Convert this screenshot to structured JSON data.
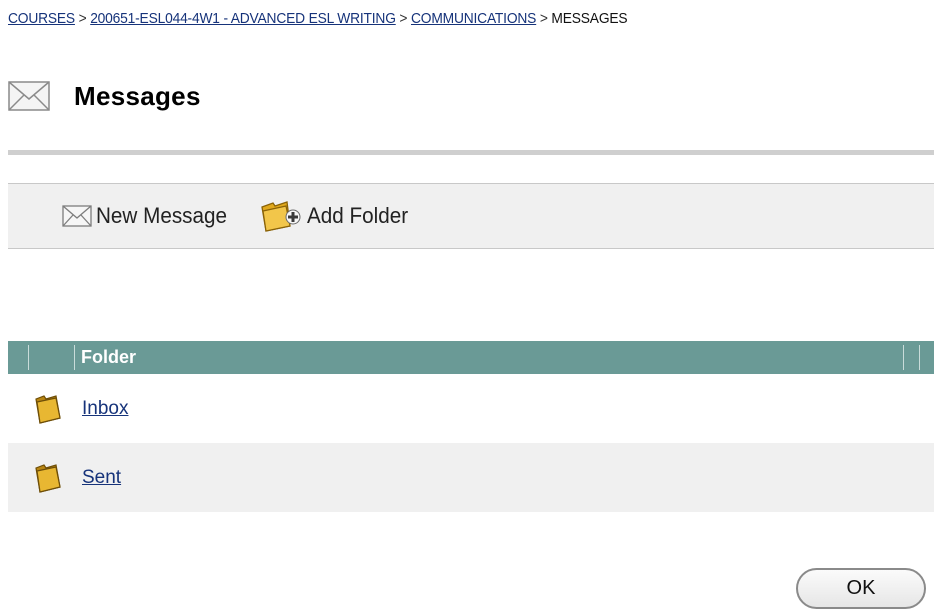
{
  "breadcrumb": {
    "courses": "COURSES",
    "course": "200651-ESL044-4W1 - ADVANCED ESL WRITING",
    "communications": "COMMUNICATIONS",
    "current": "MESSAGES",
    "separator": ">"
  },
  "page": {
    "title": "Messages",
    "icon": "envelope-icon"
  },
  "actions": {
    "new_message": "New Message",
    "add_folder": "Add Folder"
  },
  "table": {
    "header": "Folder",
    "header_color": "#6a9a96",
    "rows": [
      {
        "label": "Inbox",
        "icon": "folder-icon"
      },
      {
        "label": "Sent",
        "icon": "folder-icon"
      }
    ]
  },
  "buttons": {
    "ok": "OK"
  },
  "colors": {
    "link": "#16337a",
    "folder": "#e0a81c",
    "bar_bg": "#f0f0f0"
  }
}
